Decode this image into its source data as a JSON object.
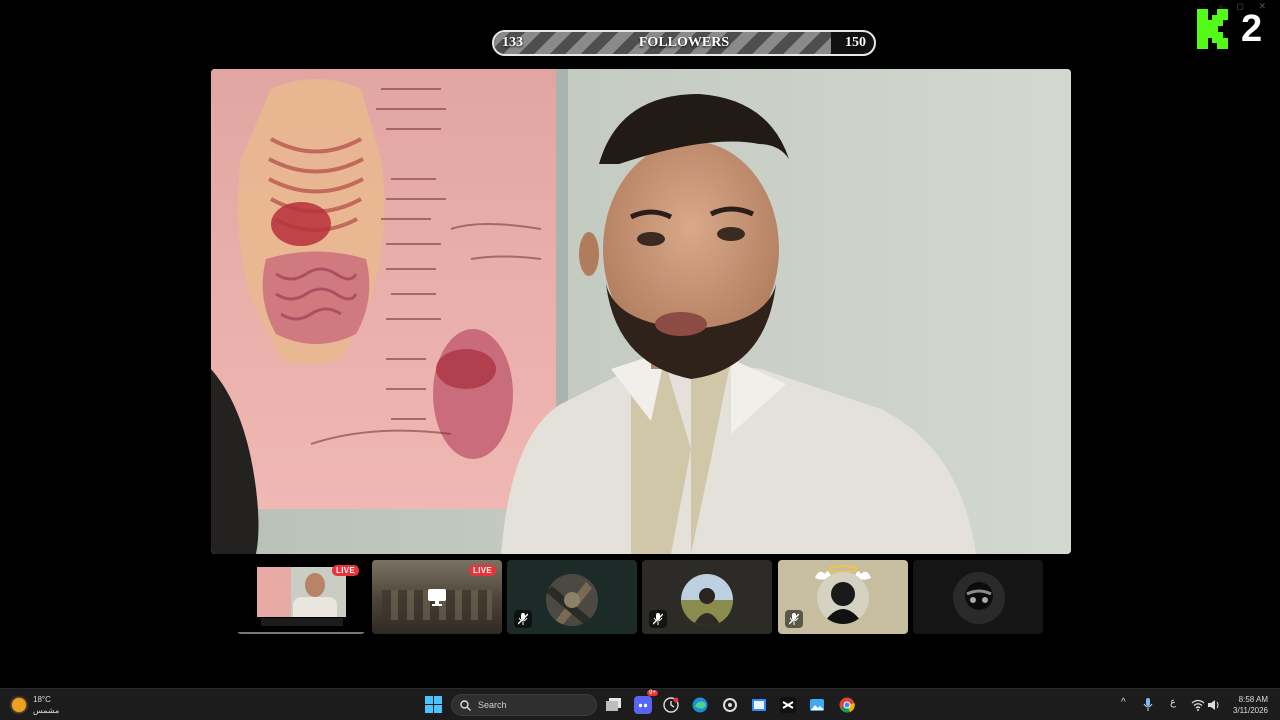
{
  "goal": {
    "current": "133",
    "label": "FOLLOWERS",
    "target": "150",
    "progress": 0.886
  },
  "logo": {
    "text": "2",
    "color": "#53fc18"
  },
  "participants": [
    {
      "name": "stream-preview",
      "live": "LIVE"
    },
    {
      "name": "screen-share",
      "live": "LIVE"
    },
    {
      "name": "member-3",
      "mic": "muted"
    },
    {
      "name": "member-4",
      "mic": "muted"
    },
    {
      "name": "member-5",
      "mic": "muted"
    },
    {
      "name": "member-6"
    }
  ],
  "taskbar": {
    "weather": {
      "temp": "18°C",
      "condition": "مشمس"
    },
    "search_label": "Search",
    "discord_badge": "9+",
    "language": "ع",
    "time": "8:58 AM",
    "date": "3/11/2026"
  },
  "colors": {
    "live": "#e8333a",
    "kick_green": "#53fc18",
    "taskbar": "#1c1c1c"
  }
}
